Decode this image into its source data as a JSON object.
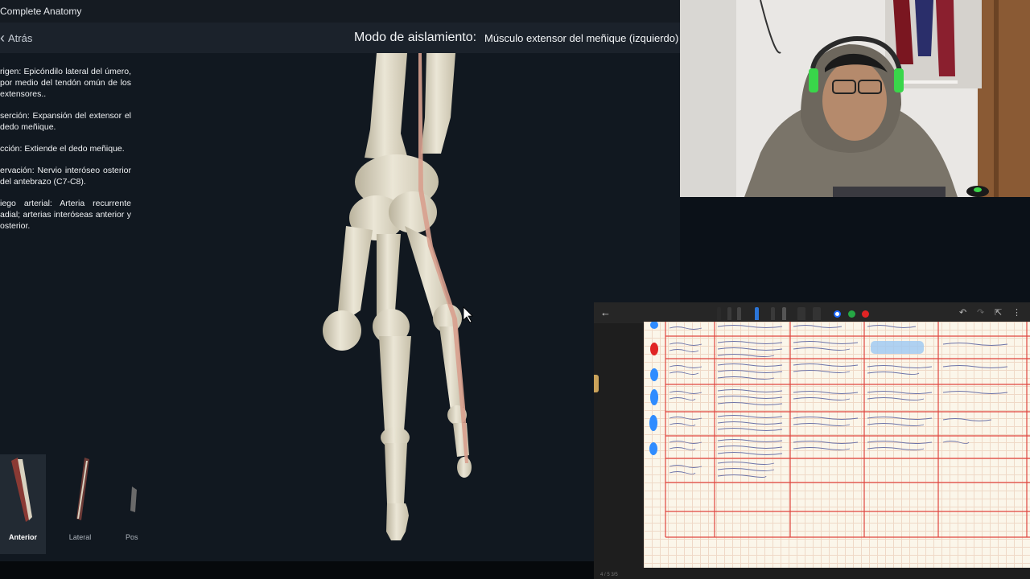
{
  "app": {
    "title": "Complete Anatomy",
    "back_label": "Atrás",
    "mode_label": "Modo de aislamiento:",
    "mode_value": "Músculo extensor del meñique (izquierdo)"
  },
  "info": {
    "origin": "rigen: Epicóndilo lateral del úmero, por medio del tendón omún de los extensores..",
    "insertion": "serción: Expansión del extensor el dedo meñique.",
    "action": "cción: Extiende el dedo meñique.",
    "innervation": "ervación: Nervio interóseo osterior del antebrazo (C7-C8).",
    "blood_supply": "iego arterial: Arteria recurrente adial; arterias interóseas anterior y osterior."
  },
  "views": [
    {
      "label": "Anterior",
      "active": true
    },
    {
      "label": "Lateral",
      "active": false
    },
    {
      "label": "Pos",
      "active": false
    }
  ],
  "notes": {
    "footer": "4 / 5    3/5",
    "colors": [
      "#1e6bff",
      "#25a744",
      "#e02424"
    ],
    "ink_red": "#e0453f",
    "ink_blue": "#2f8cff",
    "ink_handwriting": "#6c73a8"
  }
}
